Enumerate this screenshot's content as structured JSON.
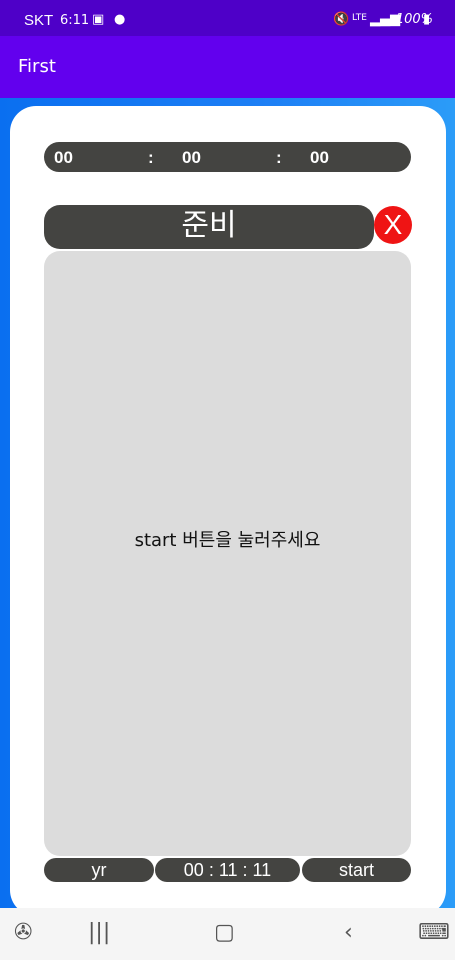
{
  "status_bar": {
    "carrier": "SKT",
    "time": "6:11",
    "battery": "100%"
  },
  "appbar": {
    "title": "First"
  },
  "timer": {
    "hours": "00",
    "minutes": "00",
    "seconds": "00",
    "separator": ":"
  },
  "game": {
    "state_label": "준비",
    "close_label": "X",
    "message": "start 버튼을 눌러주세요"
  },
  "controls": {
    "left_label": "yr",
    "clock": "00 : 11 : 11",
    "start_label": "start"
  },
  "colors": {
    "status_bar": "#4e00c8",
    "appbar": "#6200ee",
    "pill": "#444441",
    "close": "#ef1414",
    "game_area": "#dcdcdc"
  }
}
